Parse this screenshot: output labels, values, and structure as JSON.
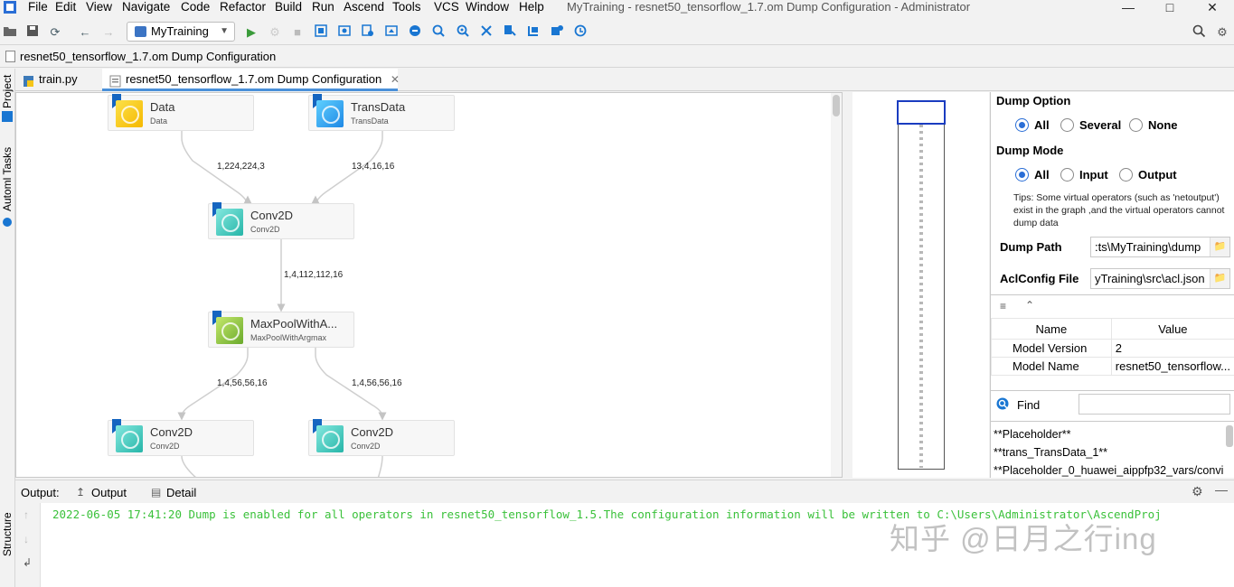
{
  "menu": {
    "items": [
      "File",
      "Edit",
      "View",
      "Navigate",
      "Code",
      "Refactor",
      "Build",
      "Run",
      "Ascend",
      "Tools",
      "VCS",
      "Window",
      "Help"
    ],
    "window_title": "MyTraining - resnet50_tensorflow_1.7.om Dump Configuration - Administrator"
  },
  "toolbar": {
    "run_config": "MyTraining"
  },
  "breadcrumb": "resnet50_tensorflow_1.7.om Dump Configuration",
  "left_strip": {
    "project": "Project",
    "tasks": "Automl Tasks",
    "structure": "Structure"
  },
  "tabs": [
    {
      "label": "train.py"
    },
    {
      "label": "resnet50_tensorflow_1.7.om Dump Configuration"
    }
  ],
  "graph": {
    "nodes": [
      {
        "title": "Data",
        "sub": "Data",
        "color": "#f5c518"
      },
      {
        "title": "TransData",
        "sub": "TransData",
        "color": "#29b6f6"
      },
      {
        "title": "Conv2D",
        "sub": "Conv2D",
        "color": "#4dd0c4"
      },
      {
        "title": "MaxPoolWithA...",
        "sub": "MaxPoolWithArgmax",
        "color": "#8bc34a"
      },
      {
        "title": "Conv2D",
        "sub": "Conv2D",
        "color": "#4dd0c4"
      },
      {
        "title": "Conv2D",
        "sub": "Conv2D",
        "color": "#4dd0c4"
      }
    ],
    "edges": [
      "1,224,224,3",
      "13,4,16,16",
      "1,4,112,112,16",
      "1,4,56,56,16",
      "1,4,56,56,16"
    ]
  },
  "dump": {
    "option_title": "Dump Option",
    "options": [
      "All",
      "Several",
      "None"
    ],
    "option_selected": "All",
    "mode_title": "Dump Mode",
    "modes": [
      "All",
      "Input",
      "Output"
    ],
    "mode_selected": "All",
    "tips": "Tips: Some virtual operators (such as 'netoutput') exist in the graph ,and the virtual operators cannot dump data",
    "path_label": "Dump Path",
    "path_value": ":ts\\MyTraining\\dump",
    "aclconfig_label": "AclConfig File",
    "aclconfig_value": "yTraining\\src\\acl.json"
  },
  "properties": {
    "headers": [
      "Name",
      "Value"
    ],
    "rows": [
      {
        "name": "Model Version",
        "value": "2"
      },
      {
        "name": "Model Name",
        "value": "resnet50_tensorflow..."
      }
    ]
  },
  "find": {
    "label": "Find",
    "value": "",
    "results": [
      "**Placeholder**",
      "**trans_TransData_1**",
      "**Placeholder_0_huawei_aippfp32_vars/convi"
    ]
  },
  "output": {
    "title": "Output:",
    "tabs": [
      "Output",
      "Detail"
    ],
    "line": "2022-06-05 17:41:20  Dump is enabled for all operators in resnet50_tensorflow_1.5.The configuration information will be written to C:\\Users\\Administrator\\AscendProj"
  },
  "watermark": "知乎 @日月之行ing",
  "colors": {
    "accent": "#2a6ed6",
    "output_text": "#3ac13a",
    "minimap_selection": "#1a3cc0"
  }
}
